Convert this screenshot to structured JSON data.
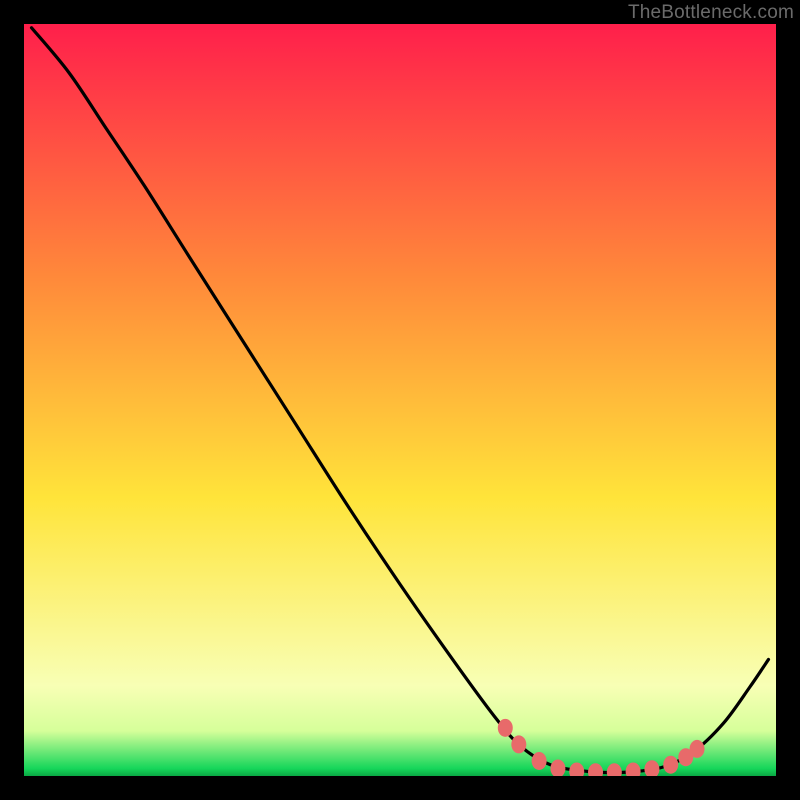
{
  "watermark": "TheBottleneck.com",
  "colors": {
    "top": "#ff1f4b",
    "mid_warm": "#ff8a3a",
    "yellow": "#ffe43a",
    "pale": "#f8ffb5",
    "green": "#16d65a",
    "curve": "#000000",
    "marker": "#e86a6a",
    "border": "#000000"
  },
  "chart_data": {
    "type": "line",
    "title": "",
    "xlabel": "",
    "ylabel": "",
    "xlim": [
      0,
      100
    ],
    "ylim": [
      0,
      100
    ],
    "curve": [
      {
        "x": 1.0,
        "y": 99.5
      },
      {
        "x": 6.0,
        "y": 93.5
      },
      {
        "x": 11.0,
        "y": 86.0
      },
      {
        "x": 16.0,
        "y": 78.5
      },
      {
        "x": 22.0,
        "y": 69.0
      },
      {
        "x": 29.0,
        "y": 58.0
      },
      {
        "x": 36.0,
        "y": 47.0
      },
      {
        "x": 43.0,
        "y": 36.0
      },
      {
        "x": 50.0,
        "y": 25.5
      },
      {
        "x": 57.0,
        "y": 15.5
      },
      {
        "x": 62.5,
        "y": 8.0
      },
      {
        "x": 66.0,
        "y": 4.0
      },
      {
        "x": 70.0,
        "y": 1.5
      },
      {
        "x": 75.0,
        "y": 0.6
      },
      {
        "x": 80.0,
        "y": 0.5
      },
      {
        "x": 85.0,
        "y": 1.2
      },
      {
        "x": 89.0,
        "y": 3.2
      },
      {
        "x": 93.0,
        "y": 7.0
      },
      {
        "x": 96.5,
        "y": 11.8
      },
      {
        "x": 99.0,
        "y": 15.5
      }
    ],
    "markers": [
      {
        "x": 64.0,
        "y": 6.4
      },
      {
        "x": 65.8,
        "y": 4.2
      },
      {
        "x": 68.5,
        "y": 2.0
      },
      {
        "x": 71.0,
        "y": 1.0
      },
      {
        "x": 73.5,
        "y": 0.6
      },
      {
        "x": 76.0,
        "y": 0.5
      },
      {
        "x": 78.5,
        "y": 0.5
      },
      {
        "x": 81.0,
        "y": 0.6
      },
      {
        "x": 83.5,
        "y": 0.9
      },
      {
        "x": 86.0,
        "y": 1.5
      },
      {
        "x": 88.0,
        "y": 2.5
      },
      {
        "x": 89.5,
        "y": 3.6
      }
    ]
  }
}
